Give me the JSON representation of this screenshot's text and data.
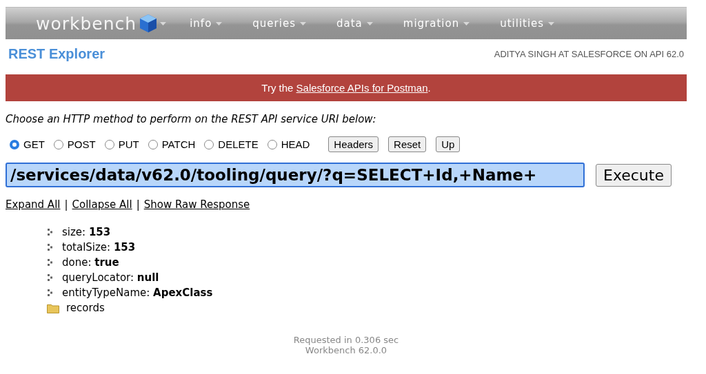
{
  "nav": {
    "logo": "workbench",
    "menus": [
      {
        "label": "info"
      },
      {
        "label": "queries"
      },
      {
        "label": "data"
      },
      {
        "label": "migration"
      },
      {
        "label": "utilities"
      }
    ]
  },
  "title": "REST Explorer",
  "user_info": "ADITYA SINGH AT SALESFORCE ON API 62.0",
  "banner": {
    "before": "Try the ",
    "link": "Salesforce APIs for Postman",
    "after": "."
  },
  "instruction": "Choose an HTTP method to perform on the REST API service URI below:",
  "methods": [
    {
      "label": "GET",
      "selected": true
    },
    {
      "label": "POST",
      "selected": false
    },
    {
      "label": "PUT",
      "selected": false
    },
    {
      "label": "PATCH",
      "selected": false
    },
    {
      "label": "DELETE",
      "selected": false
    },
    {
      "label": "HEAD",
      "selected": false
    }
  ],
  "tool_buttons": [
    "Headers",
    "Reset",
    "Up"
  ],
  "uri": "/services/data/v62.0/tooling/query/?q=SELECT+Id,+Name+",
  "execute": "Execute",
  "view_links": [
    "Expand All",
    "Collapse All",
    "Show Raw Response"
  ],
  "separator": "|",
  "tree": [
    {
      "kind": "leaf",
      "text": "size: **153**"
    },
    {
      "kind": "leaf",
      "text": "totalSize: **153**"
    },
    {
      "kind": "leaf",
      "text": "done: **true**"
    },
    {
      "kind": "leaf",
      "text": "queryLocator: **null**"
    },
    {
      "kind": "leaf",
      "text": "entityTypeName: **ApexClass**"
    },
    {
      "kind": "folder",
      "text": "records"
    }
  ],
  "footer": [
    "Requested in 0.306 sec",
    "Workbench 62.0.0"
  ]
}
